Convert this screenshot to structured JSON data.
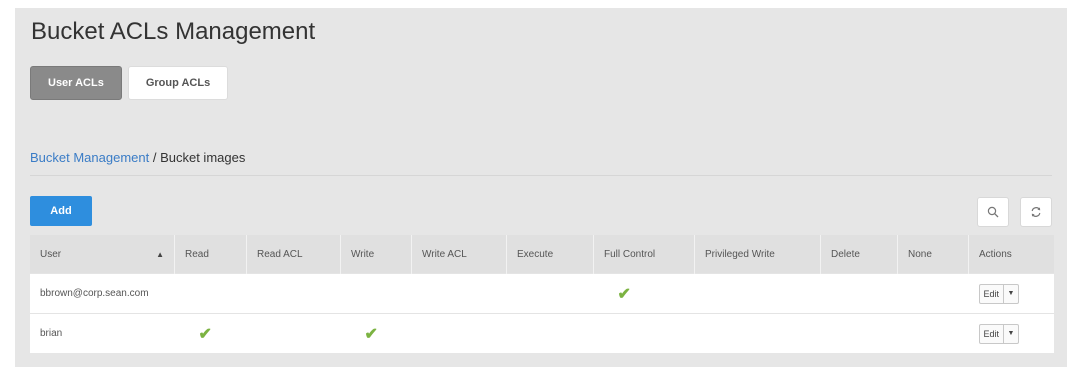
{
  "page": {
    "title": "Bucket ACLs Management"
  },
  "tabs": [
    {
      "label": "User ACLs",
      "active": true
    },
    {
      "label": "Group ACLs",
      "active": false
    }
  ],
  "breadcrumb": {
    "parent": "Bucket Management",
    "separator": " / ",
    "current": "Bucket images"
  },
  "toolbar": {
    "add_label": "Add",
    "search_icon": "search-icon",
    "refresh_icon": "refresh-icon"
  },
  "table": {
    "columns": [
      "User",
      "Read",
      "Read ACL",
      "Write",
      "Write ACL",
      "Execute",
      "Full Control",
      "Privileged Write",
      "Delete",
      "None",
      "Actions"
    ],
    "sort_indicator": "▲",
    "check_glyph": "✔",
    "edit_label": "Edit",
    "caret_glyph": "▼",
    "rows": [
      {
        "user": "bbrown@corp.sean.com",
        "read": false,
        "read_acl": false,
        "write": false,
        "write_acl": false,
        "execute": false,
        "full_control": true,
        "privileged_write": false,
        "delete": false,
        "none": false
      },
      {
        "user": "brian",
        "read": true,
        "read_acl": false,
        "write": true,
        "write_acl": false,
        "execute": false,
        "full_control": false,
        "privileged_write": false,
        "delete": false,
        "none": false
      }
    ]
  },
  "colors": {
    "accent": "#2e8ede",
    "check": "#7cb342",
    "link": "#3a7cc6"
  }
}
